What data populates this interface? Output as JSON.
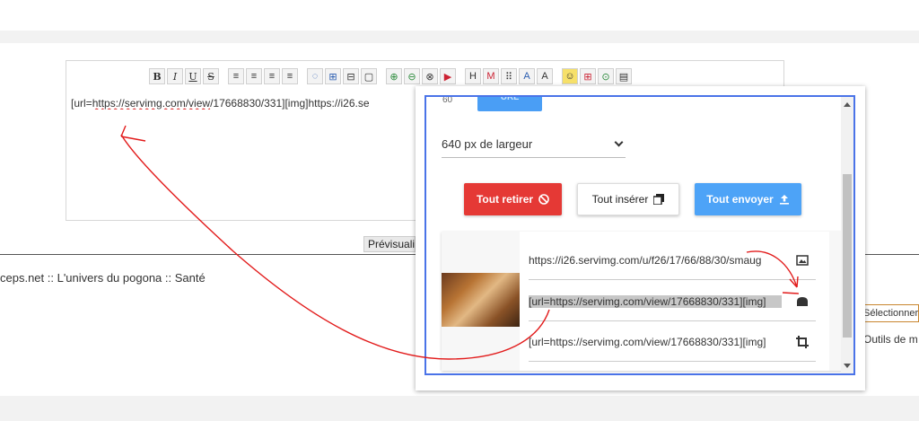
{
  "editor": {
    "toolbar": [
      "B",
      "I",
      "U",
      "S",
      "≡",
      "≡",
      "≡",
      "≡",
      "◌",
      "⊞",
      "⊟",
      "▢",
      "⊕",
      "⊖",
      "⊗",
      "▶",
      "H",
      "M",
      "⠿",
      "A",
      "A",
      "☺",
      "⊞",
      "⊙",
      "▤"
    ],
    "content_prefix": "[url=",
    "content_link": "https://servimg.com/view",
    "content_rest": "/17668830/331][img]https://i26.se",
    "preview_label": "Prévisualiser"
  },
  "breadcrumb": "ceps.net :: L'univers du pogona :: Santé",
  "right": {
    "select_label": "Sélectionner",
    "tools_label": "Outils de m"
  },
  "popup": {
    "num_label": "60",
    "url_button": "URL",
    "width_select": "640 px de largeur",
    "remove_all": "Tout retirer",
    "insert_all": "Tout insérer",
    "send_all": "Tout envoyer",
    "links": [
      {
        "text": "https://i26.servimg.com/u/f26/17/66/88/30/smaug",
        "icon": "image-icon"
      },
      {
        "text": "[url=https://servimg.com/view/17668830/331][img]",
        "icon": "insert-icon"
      },
      {
        "text": "[url=https://servimg.com/view/17668830/331][img]",
        "icon": "crop-icon"
      }
    ]
  },
  "colors": {
    "accent_blue": "#4da3f7",
    "danger_red": "#e53935",
    "annotation_red": "#e21b1b"
  }
}
